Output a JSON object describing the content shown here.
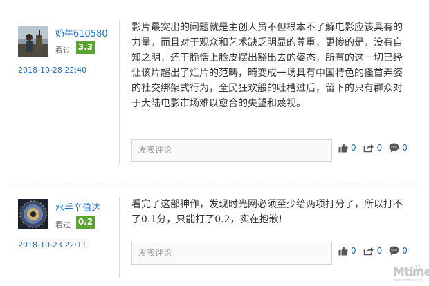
{
  "reviews": [
    {
      "username": "奶牛610580",
      "watched_label": "看过",
      "score": "3.3",
      "date": "2018-10-28 22:40",
      "lines": [
        "影片最突出的问题就是主创人员不但根本不了解电影应该具有的",
        "力量，而且对于观众和艺术缺乏明显的尊重，更惨的是，没有自",
        "知之明，还干脆恬上脸皮摆出豁出去的姿态，所有的这一切已经",
        "让该片超出了烂片的范畴，畸变成一场具有中国特色的搔首弄姿",
        "的社交绑架式行为，全民狂欢般的吐槽过后，留下的只有群众对",
        "于大陆电影市场难以愈合的失望和蔑视。"
      ],
      "comment_placeholder": "发表评论",
      "likes": "0",
      "shares": "0",
      "comments": "0"
    },
    {
      "username": "水手辛伯达",
      "watched_label": "看过",
      "score": "0.2",
      "date": "2018-10-23 22:11",
      "lines": [
        "看完了这部神作，发现时光网必须至少给两项打分了，所以打不",
        "了0.1分，只能打了0.2，实在抱歉!"
      ],
      "comment_placeholder": "发表评论",
      "likes": "0",
      "shares": "0",
      "comments": "0"
    }
  ],
  "watermark": {
    "brand": "Mtime",
    "cn": "时光网",
    "url": "www.mtime.com"
  },
  "colors": {
    "link": "#1a6fc1",
    "score_bg": "#5aa530",
    "icon": "#555555"
  },
  "icons": [
    "thumbs-up-icon",
    "share-icon",
    "comment-bubble-icon"
  ]
}
